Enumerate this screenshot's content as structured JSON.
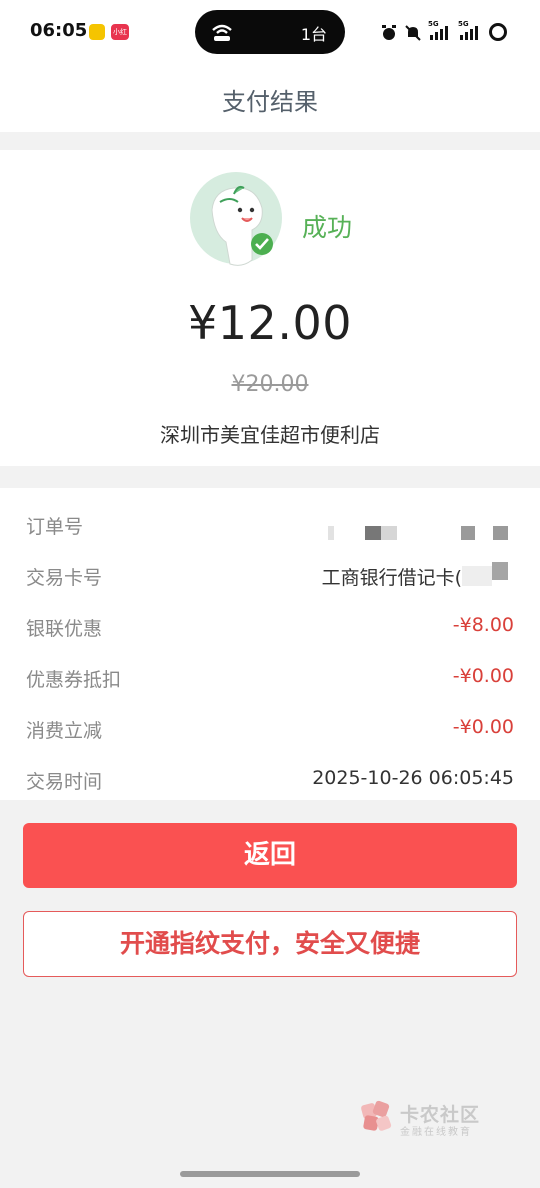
{
  "status_bar": {
    "time": "06:05",
    "notif_b_label": "小红书",
    "island_count": "1台",
    "signal_1": "5G",
    "signal_2": "5G"
  },
  "header": {
    "title": "支付结果"
  },
  "result": {
    "status": "成功",
    "amount": "¥12.00",
    "original_amount": "¥20.00",
    "merchant": "深圳市美宜佳超市便利店",
    "status_color": "#57b157"
  },
  "details": {
    "rows": [
      {
        "label": "订单号",
        "value": ""
      },
      {
        "label": "交易卡号",
        "value": "工商银行借记卡("
      },
      {
        "label": "银联优惠",
        "value": "-¥8.00"
      },
      {
        "label": "优惠券抵扣",
        "value": "-¥0.00"
      },
      {
        "label": "消费立减",
        "value": "-¥0.00"
      },
      {
        "label": "交易时间",
        "value": "2025-10-26 06:05:45"
      }
    ],
    "discount_color": "#d9403a"
  },
  "buttons": {
    "back_label": "返回",
    "fingerprint_label": "开通指纹支付，安全又便捷",
    "primary_color": "#fa5151"
  },
  "watermark": {
    "title": "卡农社区",
    "subtitle": "金融在线教育"
  }
}
